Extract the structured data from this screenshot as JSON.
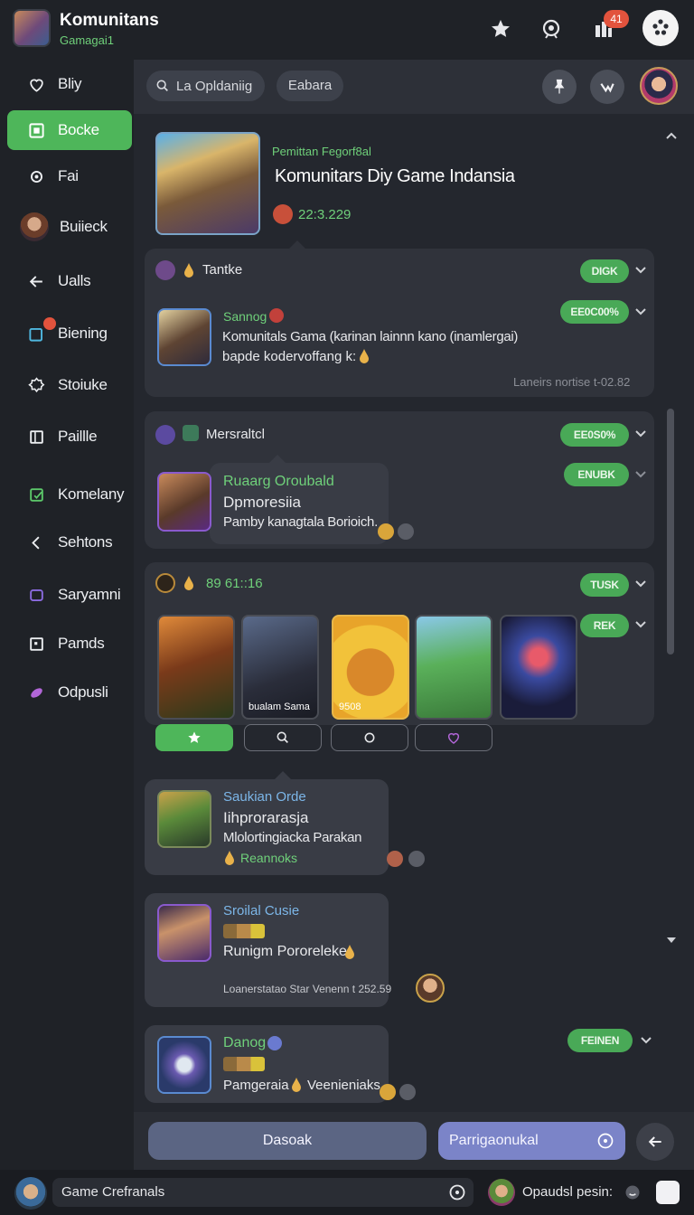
{
  "app": {
    "title": "Komunitans",
    "subtitle": "Gamagai1",
    "notification_count": "41"
  },
  "sidebar": {
    "items": [
      {
        "label": "Bliy",
        "icon": "heart-icon"
      },
      {
        "label": "Bocke",
        "icon": "square-play-icon",
        "active": true
      },
      {
        "label": "Fai",
        "icon": "gear-icon"
      },
      {
        "label": "Buiieck",
        "icon": "user-avatar"
      },
      {
        "label": "Ualls",
        "icon": "arrow-left-icon"
      },
      {
        "label": "Biening",
        "icon": "chat-square-icon"
      },
      {
        "label": "Stoiuke",
        "icon": "cog-icon"
      },
      {
        "label": "Paillle",
        "icon": "square-icon"
      },
      {
        "label": "Komelany",
        "icon": "edit-square-icon"
      },
      {
        "label": "Sehtons",
        "icon": "chevron-left-icon"
      },
      {
        "label": "Saryamni",
        "icon": "purple-square-icon"
      },
      {
        "label": "Pamds",
        "icon": "square-icon"
      },
      {
        "label": "Odpusli",
        "icon": "pill-icon"
      }
    ]
  },
  "header": {
    "search_placeholder": "La Opldaniig",
    "filter_label": "Eabara"
  },
  "feed": {
    "featured": {
      "kicker": "Pemittan Fegorf8al",
      "title": "Komunitars Diy Game Indansia",
      "meta": "22:3.229"
    },
    "post1": {
      "author": "Tantke",
      "tag": "DIGK",
      "name": "Sannog",
      "tag2": "EE0C00%",
      "line1": "Komunitals Gama (karinan lainnn kano (inamlergai)",
      "line2": "bapde kodervoffang k:",
      "footer": "Laneirs nortise  t-02.82"
    },
    "post2": {
      "author": "Mersraltcl",
      "tag": "EE0S0%",
      "tag2": "ENUBK",
      "name": "Ruaarg Oroubald",
      "line1": "Dpmoresiia",
      "line2": "Pamby kanagtala Borioich."
    },
    "post3": {
      "author": "89 61::16",
      "tag": "TUSK",
      "tag2": "REK",
      "tile2_caption": "bualam Sama",
      "tile3_caption": "9508"
    },
    "post4": {
      "name": "Saukian Orde",
      "line1": "Iihprorarasja",
      "line2": "Mlolortingiacka Parakan",
      "line3": "Reannoks"
    },
    "post5": {
      "name": "Sroilal Cusie",
      "line1": "Runigm Pororeleke",
      "footer": "Loanerstatao Star Venenn  t 252.59"
    },
    "post6": {
      "name": "Danog",
      "tag": "FEINEN",
      "line1": "Pamgeraia",
      "line2": "Veenieniaks"
    }
  },
  "composer": {
    "left_button": "Dasoak",
    "right_button": "Parrigaonukal"
  },
  "status": {
    "input_text": "Game Crefranals",
    "right_text": "Opaudsl pesin:"
  },
  "colors": {
    "accent": "#4eb65a",
    "badge": "#e2533d",
    "background": "#23262d"
  }
}
